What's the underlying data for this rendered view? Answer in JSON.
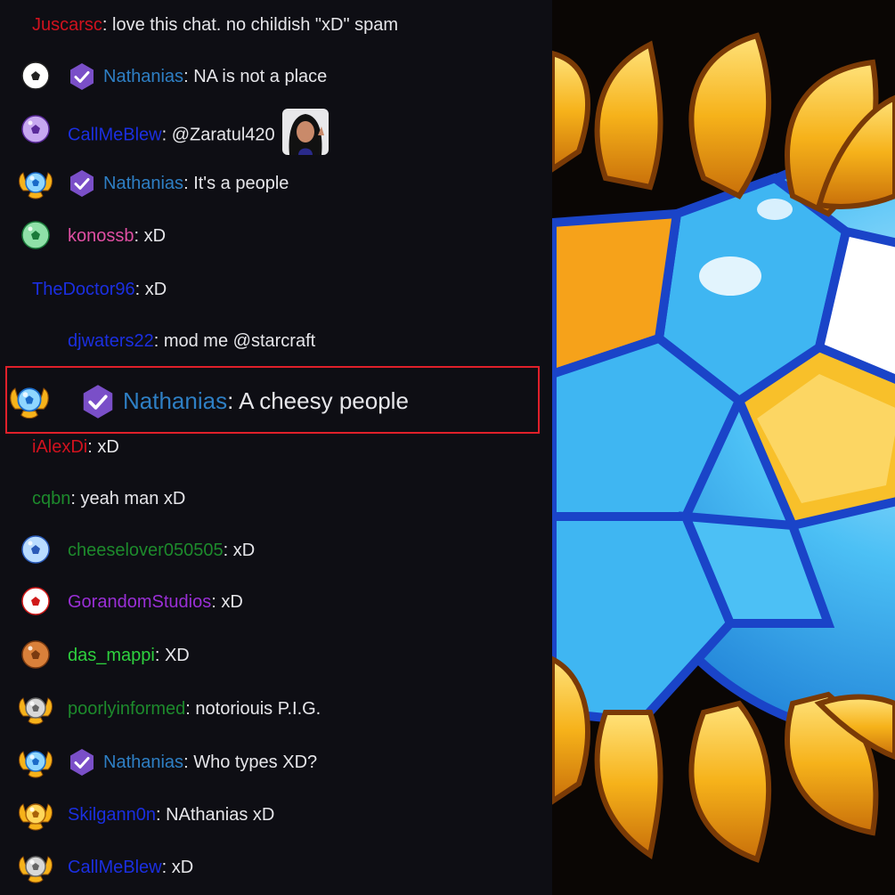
{
  "chat": {
    "messages": [
      {
        "user": "Juscarsc",
        "text": "love this chat. no childish \"xD\" spam",
        "color": "#d0121e",
        "badge": "none",
        "verified": false
      },
      {
        "user": "Nathanias",
        "text": "NA is not a place",
        "color": "#2e7fc4",
        "badge": "ball-white",
        "verified": true
      },
      {
        "user": "CallMeBlew",
        "text": "@Zaratul420",
        "color": "#1b2fe0",
        "badge": "ball-purple",
        "verified": false,
        "emote": "waving-person-emote"
      },
      {
        "user": "Nathanias",
        "text": "It's a people",
        "color": "#2e7fc4",
        "badge": "ball-blue-wings",
        "verified": true
      },
      {
        "user": "konossb",
        "text": "xD",
        "color": "#e04fa3",
        "badge": "ball-green",
        "verified": false
      },
      {
        "user": "TheDoctor96",
        "text": "xD",
        "color": "#1b2fe0",
        "badge": "none",
        "verified": false
      },
      {
        "user": "djwaters22",
        "text": "mod me @starcraft",
        "color": "#1b2fe0",
        "badge": "none",
        "verified": false
      },
      {
        "user": "Nathanias",
        "text": "A cheesy people",
        "color": "#2e7fc4",
        "badge": "ball-blue-wings",
        "verified": true,
        "highlighted": true
      },
      {
        "user": "iAlexDi",
        "text": "xD",
        "color": "#d0121e",
        "badge": "none",
        "verified": false
      },
      {
        "user": "cqbn",
        "text": "yeah man xD",
        "color": "#1d8a2c",
        "badge": "none",
        "verified": false
      },
      {
        "user": "cheeselover050505",
        "text": "xD",
        "color": "#1d8a2c",
        "badge": "ball-blue",
        "verified": false
      },
      {
        "user": "GorandomStudios",
        "text": "xD",
        "color": "#9a2fd6",
        "badge": "ball-red",
        "verified": false
      },
      {
        "user": "das_mappi",
        "text": "XD",
        "color": "#2ed13e",
        "badge": "ball-bronze",
        "verified": false
      },
      {
        "user": "poorlyinformed",
        "text": "notoriouis P.I.G.",
        "color": "#1d8a2c",
        "badge": "ball-silver-wings",
        "verified": false
      },
      {
        "user": "Nathanias",
        "text": "Who types XD?",
        "color": "#2e7fc4",
        "badge": "ball-blue-wings",
        "verified": true
      },
      {
        "user": "Skilgann0n",
        "text": "NAthanias xD",
        "color": "#1b2fe0",
        "badge": "ball-gold-wings",
        "verified": false
      },
      {
        "user": "CallMeBlew",
        "text": "xD",
        "color": "#1b2fe0",
        "badge": "ball-silver-wings",
        "verified": false
      }
    ]
  },
  "artwork": {
    "name": "soccer-ball-badge-artwork",
    "colors": {
      "blue": "#3fb6f2",
      "gold": "#f6b21a",
      "outline": "#1a44c8"
    }
  }
}
